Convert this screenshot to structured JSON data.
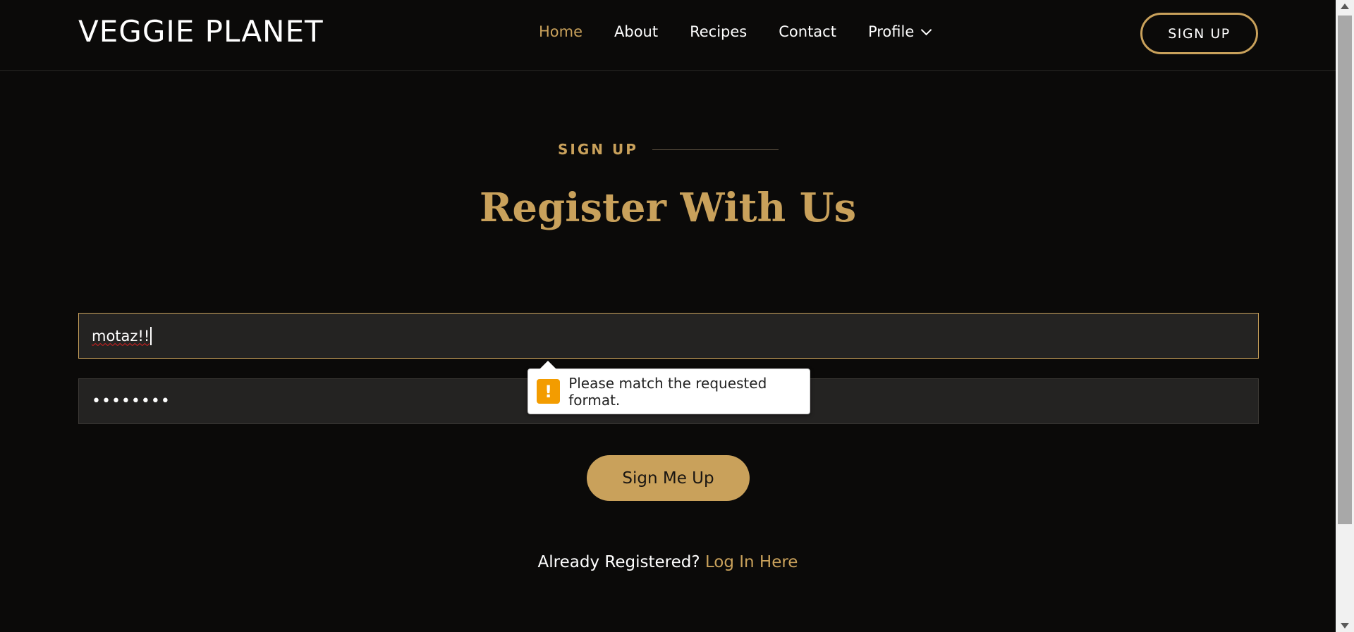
{
  "header": {
    "logo": "VEGGIE PLANET",
    "nav": {
      "home": "Home",
      "about": "About",
      "recipes": "Recipes",
      "contact": "Contact",
      "profile": "Profile"
    },
    "signup_button": "SIGN UP"
  },
  "section": {
    "eyebrow": "SIGN UP",
    "title": "Register With Us"
  },
  "form": {
    "username_value": "motaz!!",
    "password_value": "••••••••",
    "submit_label": "Sign Me Up"
  },
  "validation": {
    "icon": "!",
    "message": "Please match the requested format."
  },
  "footer": {
    "already_text": "Already Registered?",
    "login_link": "Log In Here"
  },
  "colors": {
    "background": "#0b0a09",
    "accent": "#c9a15b",
    "field_bg": "#242322",
    "warning": "#f39c00"
  }
}
